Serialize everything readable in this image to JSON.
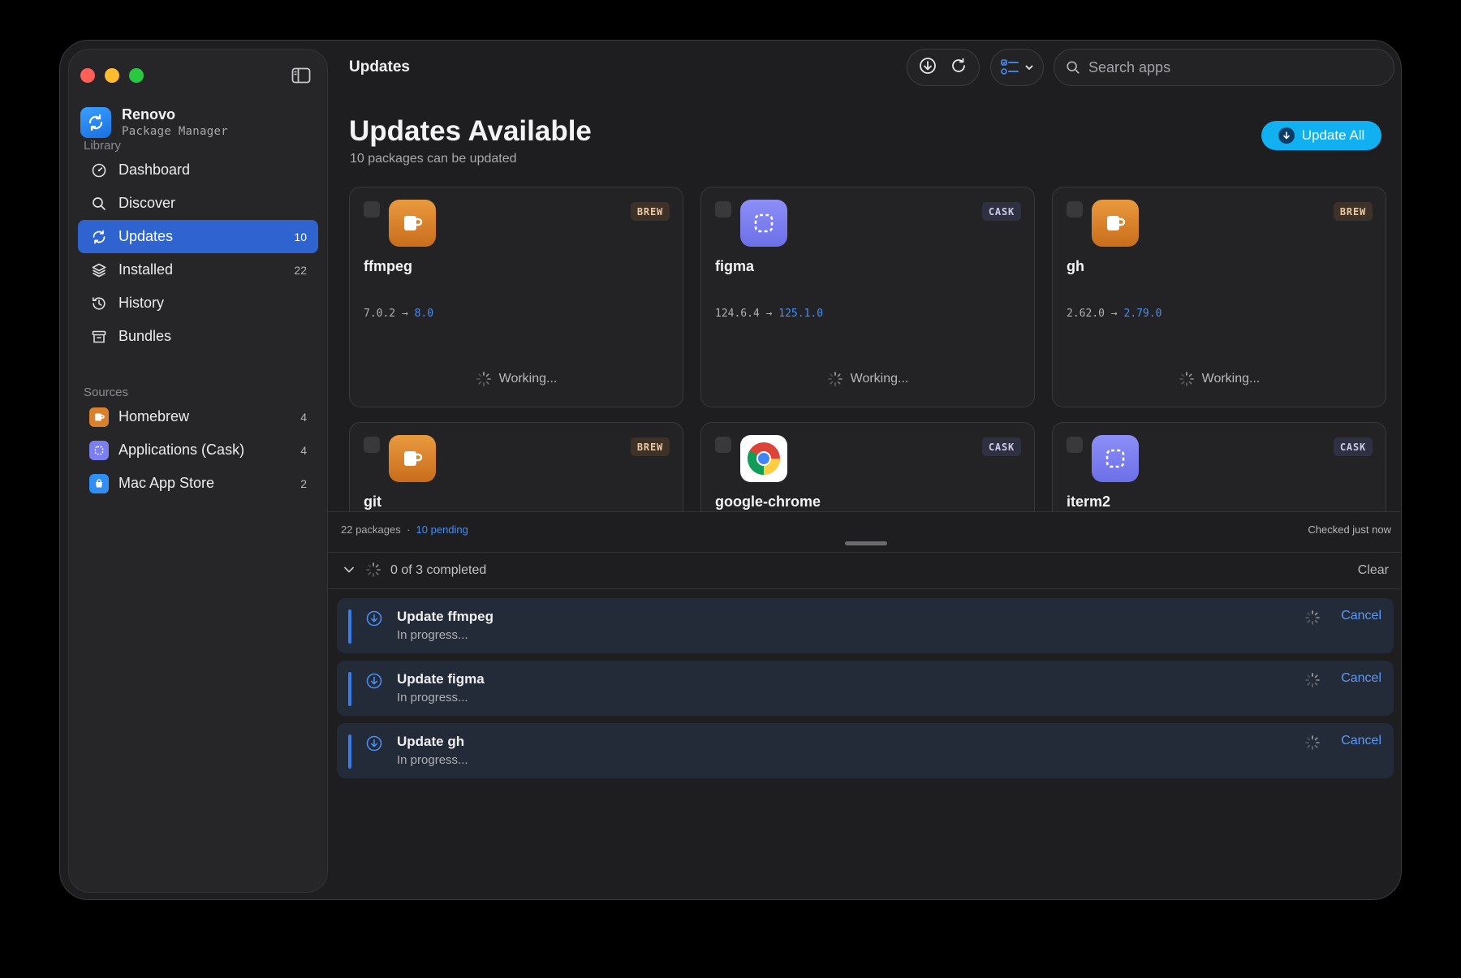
{
  "window": {
    "title": "Updates"
  },
  "sidebar": {
    "app_name": "Renovo",
    "app_subtitle": "Package Manager",
    "library_label": "Library",
    "items": [
      {
        "label": "Dashboard",
        "icon": "gauge-icon",
        "count": ""
      },
      {
        "label": "Discover",
        "icon": "search-icon",
        "count": ""
      },
      {
        "label": "Updates",
        "icon": "sync-icon",
        "count": "10",
        "active": true
      },
      {
        "label": "Installed",
        "icon": "layers-icon",
        "count": "22"
      },
      {
        "label": "History",
        "icon": "history-icon",
        "count": ""
      },
      {
        "label": "Bundles",
        "icon": "archive-icon",
        "count": ""
      }
    ],
    "sources_label": "Sources",
    "sources": [
      {
        "label": "Homebrew",
        "icon": "homebrew-icon",
        "count": "4"
      },
      {
        "label": "Applications (Cask)",
        "icon": "cask-icon",
        "count": "4"
      },
      {
        "label": "Mac App Store",
        "icon": "app-store-icon",
        "count": "2"
      }
    ]
  },
  "toolbar": {
    "search_placeholder": "Search apps"
  },
  "header": {
    "title": "Updates Available",
    "subtitle": "10 packages can be updated",
    "update_all_label": "Update All"
  },
  "packages": [
    {
      "name": "ffmpeg",
      "type": "BREW",
      "from": "7.0.2",
      "to": "8.0",
      "status": "Working..."
    },
    {
      "name": "figma",
      "type": "CASK",
      "from": "124.6.4",
      "to": "125.1.0",
      "status": "Working..."
    },
    {
      "name": "gh",
      "type": "BREW",
      "from": "2.62.0",
      "to": "2.79.0",
      "status": "Working..."
    },
    {
      "name": "git",
      "type": "BREW",
      "from": "",
      "to": "",
      "status": ""
    },
    {
      "name": "google-chrome",
      "type": "CASK",
      "from": "",
      "to": "",
      "status": ""
    },
    {
      "name": "iterm2",
      "type": "CASK",
      "from": "",
      "to": "",
      "status": ""
    }
  ],
  "statusbar": {
    "packages": "22 packages",
    "separator": "·",
    "pending": "10 pending",
    "checked": "Checked just now"
  },
  "queue": {
    "progress": "0 of 3 completed",
    "clear_label": "Clear",
    "jobs": [
      {
        "title": "Update ffmpeg",
        "status": "In progress...",
        "cancel": "Cancel"
      },
      {
        "title": "Update figma",
        "status": "In progress...",
        "cancel": "Cancel"
      },
      {
        "title": "Update gh",
        "status": "In progress...",
        "cancel": "Cancel"
      }
    ]
  },
  "colors": {
    "accent": "#2f64d0",
    "update_all": "#11b0f0",
    "link": "#4a8df0",
    "brew": "#d9812c",
    "cask": "#7c7ff2"
  }
}
